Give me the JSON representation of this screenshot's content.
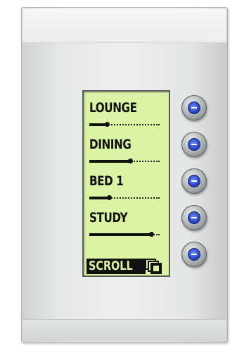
{
  "keypad": {
    "zones": [
      {
        "label": "LOUNGE",
        "level": 0.25
      },
      {
        "label": "DINING",
        "level": 0.58
      },
      {
        "label": "BED 1",
        "level": 0.28
      },
      {
        "label": "STUDY",
        "level": 0.88
      }
    ],
    "scroll": {
      "label": "SCROLL",
      "icon": "pages-icon"
    },
    "buttons": [
      {
        "icon": "minus-icon"
      },
      {
        "icon": "minus-icon"
      },
      {
        "icon": "minus-icon"
      },
      {
        "icon": "minus-icon"
      },
      {
        "icon": "minus-icon"
      }
    ],
    "colors": {
      "lcd_background": "#dbf3a5",
      "lcd_ink": "#111111",
      "button_accent": "#2846c8"
    }
  }
}
